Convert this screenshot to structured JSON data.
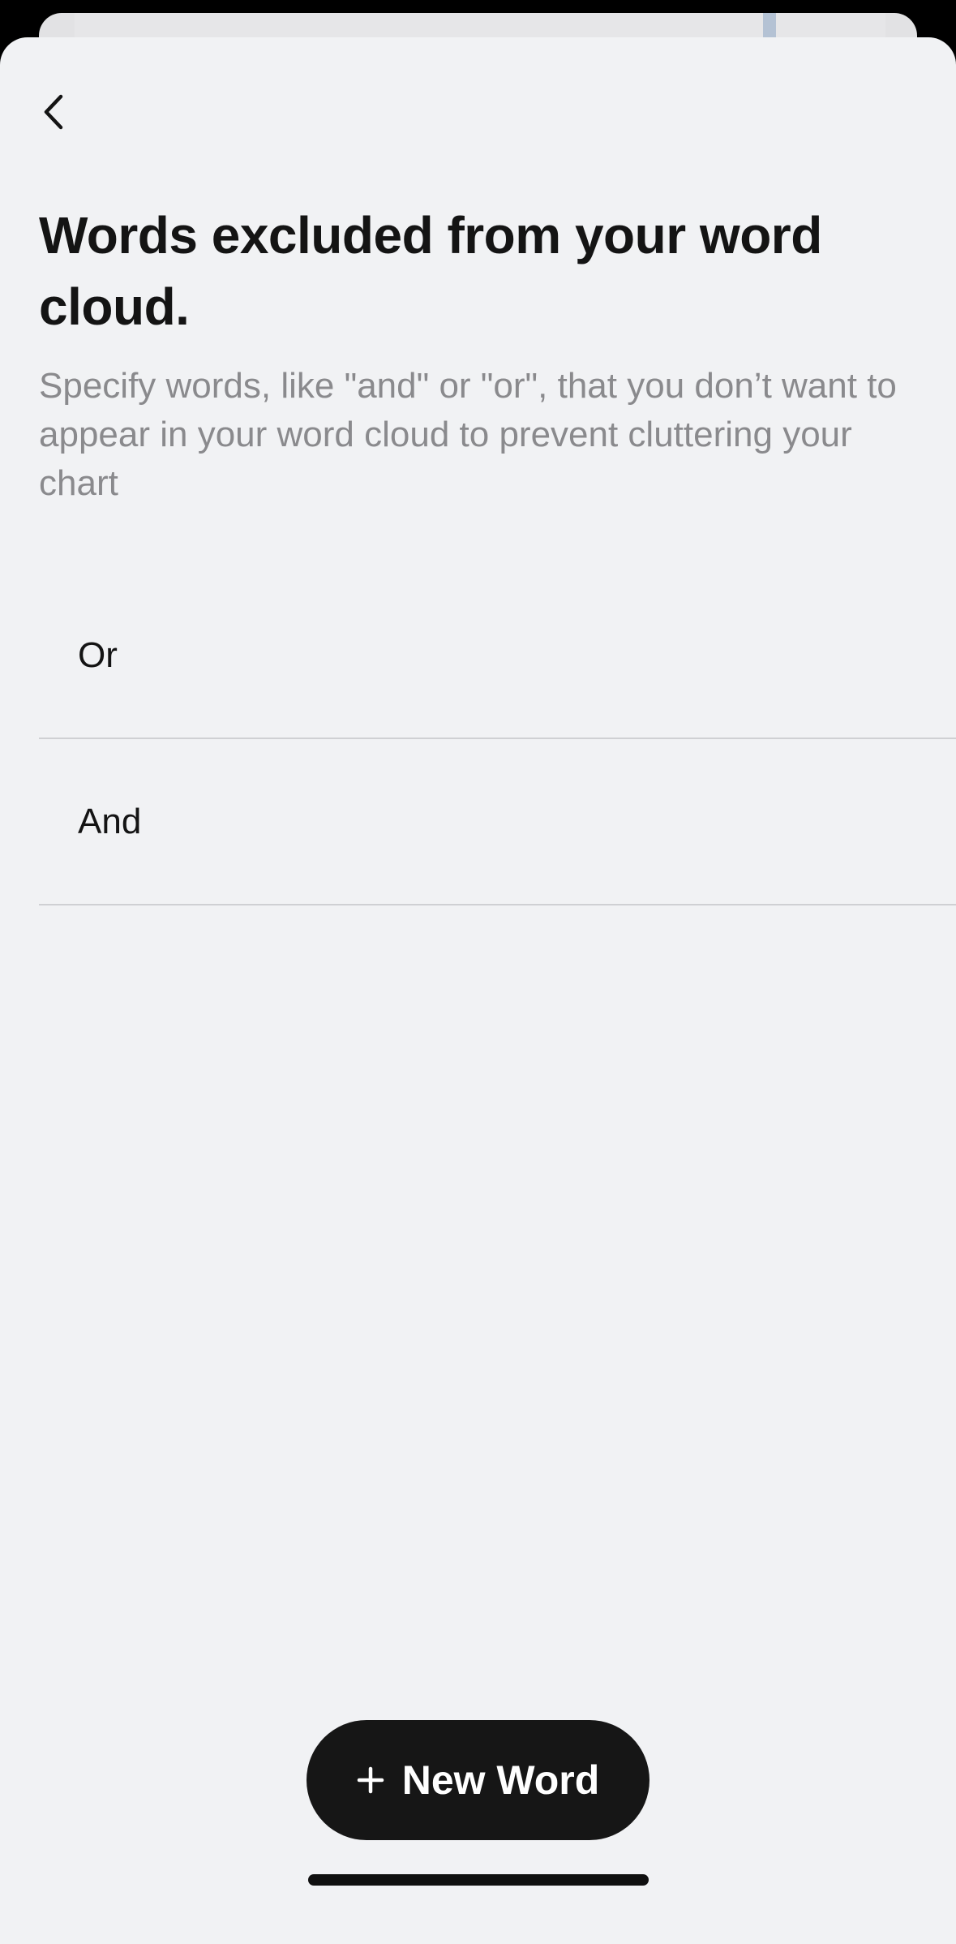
{
  "screen": {
    "title": "Words excluded from your word cloud.",
    "description": "Specify words, like \"and\" or \"or\", that you don’t want to appear in your word cloud to prevent cluttering your chart"
  },
  "nav": {
    "back_icon": "chevron-left-icon"
  },
  "excluded_words": [
    {
      "label": "Or"
    },
    {
      "label": "And"
    }
  ],
  "actions": {
    "new_word_label": "New Word",
    "new_word_icon": "plus-icon"
  },
  "colors": {
    "background": "#f1f2f4",
    "text_primary": "#141414",
    "text_secondary": "#8a8a8d",
    "button_bg": "#161616",
    "button_text": "#ffffff",
    "divider": "#cfd0d3"
  }
}
